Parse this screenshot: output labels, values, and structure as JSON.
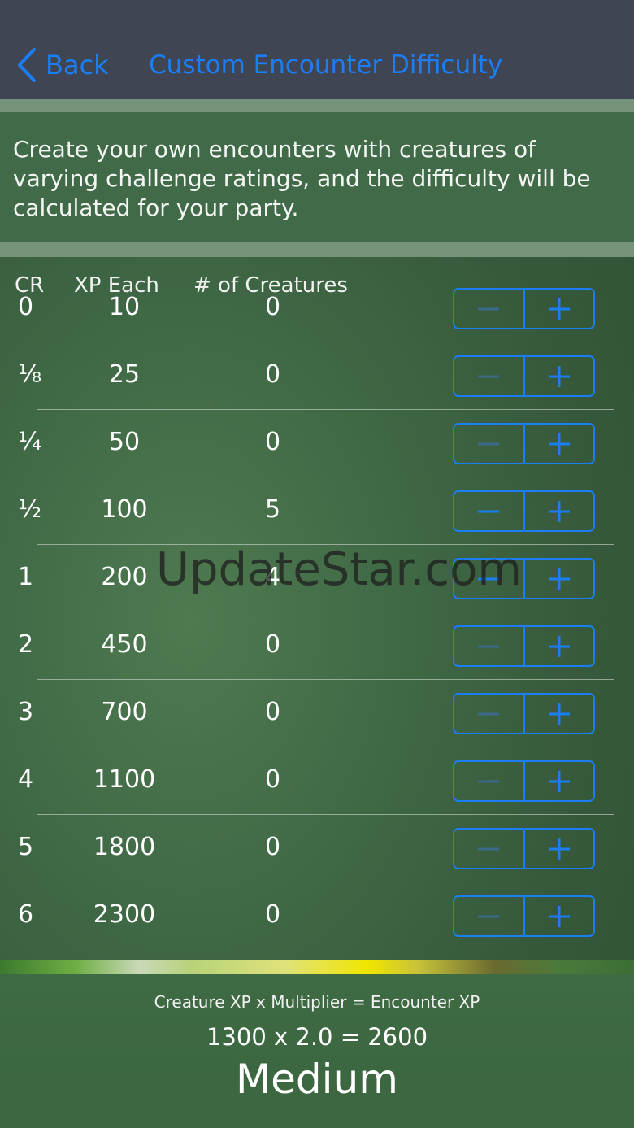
{
  "nav": {
    "back_label": "Back",
    "title": "Custom Encounter Difficulty"
  },
  "intro": {
    "text": "Create your own encounters with creatures of varying challenge ratings, and the difficulty will be calculated for your party."
  },
  "table": {
    "headers": {
      "cr": "CR",
      "xp": "XP Each",
      "count": "# of Creatures"
    },
    "rows": [
      {
        "cr": "0",
        "xp": "10",
        "count": "0"
      },
      {
        "cr": "⅛",
        "xp": "25",
        "count": "0"
      },
      {
        "cr": "¼",
        "xp": "50",
        "count": "0"
      },
      {
        "cr": "½",
        "xp": "100",
        "count": "5"
      },
      {
        "cr": "1",
        "xp": "200",
        "count": "4"
      },
      {
        "cr": "2",
        "xp": "450",
        "count": "0"
      },
      {
        "cr": "3",
        "xp": "700",
        "count": "0"
      },
      {
        "cr": "4",
        "xp": "1100",
        "count": "0"
      },
      {
        "cr": "5",
        "xp": "1800",
        "count": "0"
      },
      {
        "cr": "6",
        "xp": "2300",
        "count": "0"
      }
    ]
  },
  "watermark": "UpdateStar.com",
  "footer": {
    "formula": "Creature XP x Multiplier = Encounter XP",
    "calculation": "1300 x 2.0 = 2600",
    "difficulty": "Medium"
  },
  "colors": {
    "accent": "#1b7ef5",
    "nav_background": "#3f4552"
  },
  "icons": {
    "back": "chevron-left-icon",
    "decrement": "minus-icon",
    "increment": "plus-icon"
  }
}
